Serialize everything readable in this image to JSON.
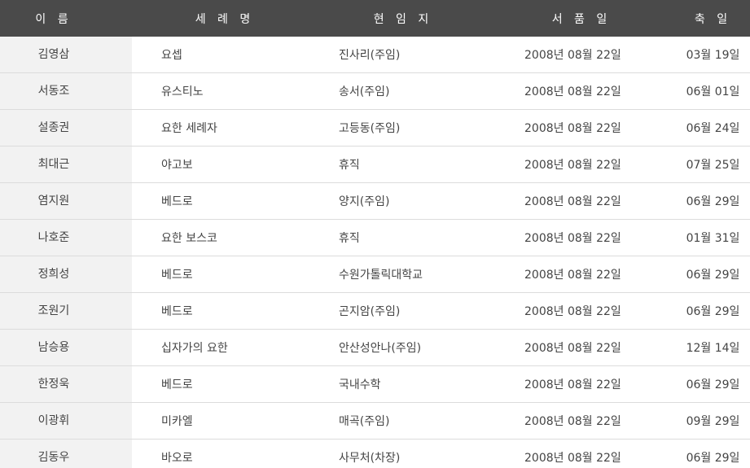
{
  "header": {
    "name": "이 름",
    "baptism": "세 례 명",
    "post": "현 임 지",
    "ordination": "서 품 일",
    "feast": "축 일"
  },
  "rows": [
    {
      "name": "김영삼",
      "baptism": "요셉",
      "post": "진사리(주임)",
      "ordination": "2008년 08월 22일",
      "feast": "03월 19일"
    },
    {
      "name": "서동조",
      "baptism": "유스티노",
      "post": "송서(주임)",
      "ordination": "2008년 08월 22일",
      "feast": "06월 01일"
    },
    {
      "name": "설종권",
      "baptism": "요한 세례자",
      "post": "고등동(주임)",
      "ordination": "2008년 08월 22일",
      "feast": "06월 24일"
    },
    {
      "name": "최대근",
      "baptism": "야고보",
      "post": "휴직",
      "ordination": "2008년 08월 22일",
      "feast": "07월 25일"
    },
    {
      "name": "염지원",
      "baptism": "베드로",
      "post": "양지(주임)",
      "ordination": "2008년 08월 22일",
      "feast": "06월 29일"
    },
    {
      "name": "나호준",
      "baptism": "요한 보스코",
      "post": "휴직",
      "ordination": "2008년 08월 22일",
      "feast": "01월 31일"
    },
    {
      "name": "정희성",
      "baptism": "베드로",
      "post": "수원가톨릭대학교",
      "ordination": "2008년 08월 22일",
      "feast": "06월 29일"
    },
    {
      "name": "조원기",
      "baptism": "베드로",
      "post": "곤지암(주임)",
      "ordination": "2008년 08월 22일",
      "feast": "06월 29일"
    },
    {
      "name": "남승용",
      "baptism": "십자가의 요한",
      "post": "안산성안나(주임)",
      "ordination": "2008년 08월 22일",
      "feast": "12월 14일"
    },
    {
      "name": "한정욱",
      "baptism": "베드로",
      "post": "국내수학",
      "ordination": "2008년 08월 22일",
      "feast": "06월 29일"
    },
    {
      "name": "이광휘",
      "baptism": "미카엘",
      "post": "매곡(주임)",
      "ordination": "2008년 08월 22일",
      "feast": "09월 29일"
    },
    {
      "name": "김동우",
      "baptism": "바오로",
      "post": "사무처(차장)",
      "ordination": "2008년 08월 22일",
      "feast": "06월 29일"
    }
  ]
}
